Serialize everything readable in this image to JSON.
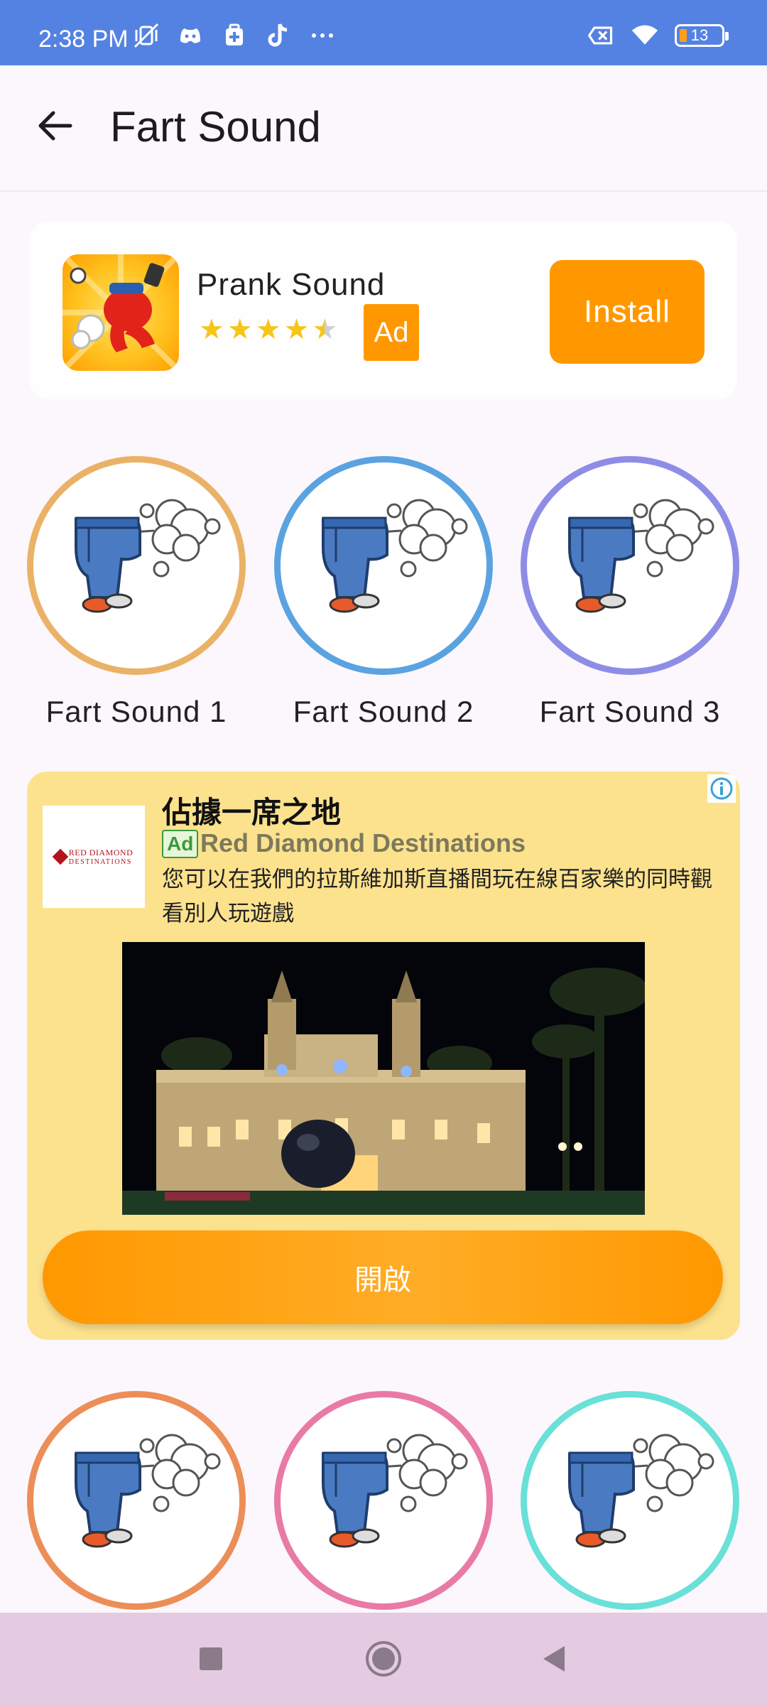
{
  "status_bar": {
    "time": "2:38 PM",
    "battery": "13",
    "left_icons": [
      "mute-vibrate-icon",
      "discord-icon",
      "medkit-icon",
      "tiktok-icon",
      "more-dots-icon"
    ],
    "right_icons": [
      "no-sim-icon",
      "wifi-icon",
      "battery-icon"
    ]
  },
  "app_bar": {
    "title": "Fart Sound",
    "back_icon": "arrow-back-icon"
  },
  "top_ad": {
    "app_name": "Prank Sound",
    "rating": 4.5,
    "ad_label": "Ad",
    "install_label": "Install"
  },
  "sounds": [
    {
      "label": "Fart Sound 1",
      "ring_color": "#eab266"
    },
    {
      "label": "Fart Sound 2",
      "ring_color": "#5ba3e0"
    },
    {
      "label": "Fart Sound 3",
      "ring_color": "#8e8de6"
    },
    {
      "label": "",
      "ring_color": "#ec8e58"
    },
    {
      "label": "",
      "ring_color": "#e87aa5"
    },
    {
      "label": "",
      "ring_color": "#69e0d8"
    }
  ],
  "native_ad": {
    "headline": "佔據一席之地",
    "ad_tag": "Ad",
    "advertiser": "Red Diamond Destinations",
    "body": "您可以在我們的拉斯維加斯直播間玩在線百家樂的同時觀看別人玩遊戲",
    "logo_line1": "RED DIAMOND",
    "logo_line2": "DESTINATIONS",
    "cta": "開啟"
  },
  "colors": {
    "status_bar": "#5482e3",
    "accent": "#ff9800",
    "native_ad_bg": "#fde28e",
    "nav_bar": "#e4cbe1"
  },
  "nav_bar": [
    "square-recents-icon",
    "circle-home-icon",
    "triangle-back-icon"
  ]
}
